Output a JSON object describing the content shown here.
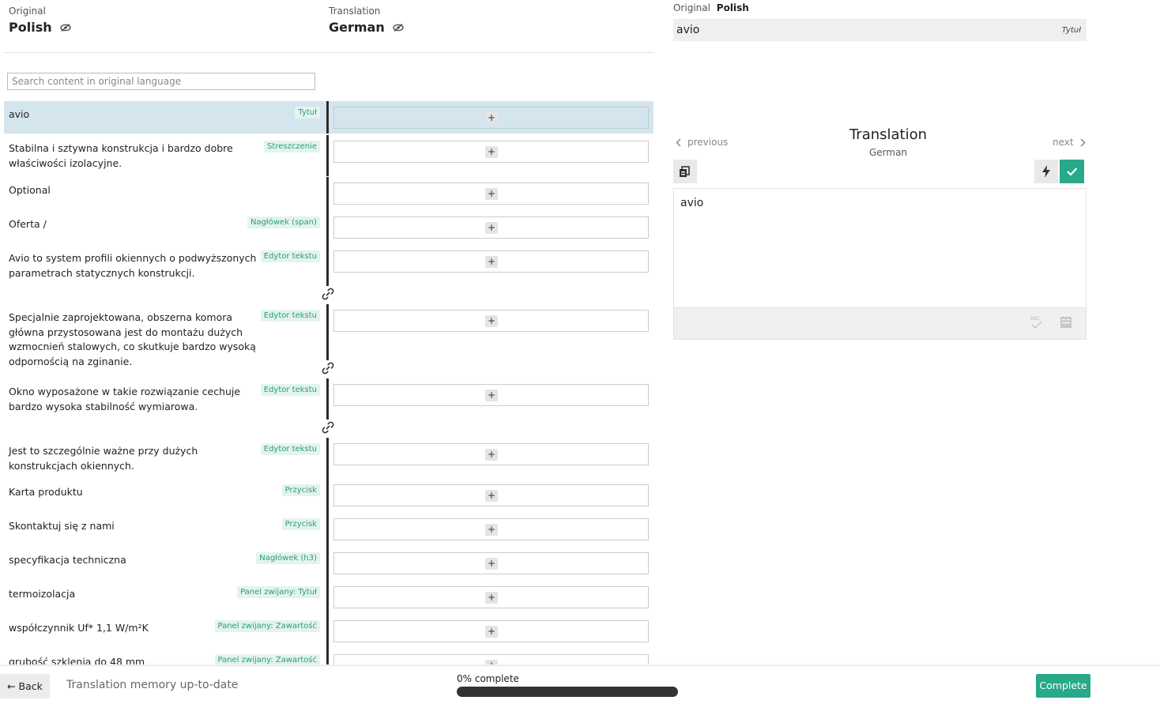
{
  "original": {
    "caption": "Original",
    "language": "Polish"
  },
  "translation": {
    "caption": "Translation",
    "language": "German"
  },
  "search": {
    "placeholder": "Search content in original language"
  },
  "segments": [
    {
      "text": "avio",
      "tag": "Tytuł"
    },
    {
      "text": "Stabilna i sztywna konstrukcja i bardzo dobre właściwości izolacyjne.",
      "tag": "Streszczenie"
    },
    {
      "text": "Optional",
      "tag": ""
    },
    {
      "text": "Oferta /",
      "tag": "Nagłówek (span)"
    },
    {
      "text": "Avio to system profili okiennych o podwyższonych parametrach statycznych konstrukcji.",
      "tag": "Edytor tekstu"
    },
    {
      "text": "Specjalnie zaprojektowana, obszerna komora główna przystosowana jest do montażu dużych wzmocnień stalowych, co skutkuje bardzo wysoką odpornością na zginanie.",
      "tag": "Edytor tekstu"
    },
    {
      "text": "Okno wyposażone w takie rozwiązanie cechuje bardzo wysoka stabilność wymiarowa.",
      "tag": "Edytor tekstu"
    },
    {
      "text": "Jest to szczególnie ważne przy dużych konstrukcjach okiennych.",
      "tag": "Edytor tekstu"
    },
    {
      "text": "Karta produktu",
      "tag": "Przycisk"
    },
    {
      "text": "Skontaktuj się z nami",
      "tag": "Przycisk"
    },
    {
      "text": "specyfikacja techniczna",
      "tag": "Nagłówek (h3)"
    },
    {
      "text": "termoizolacja",
      "tag": "Panel zwijany: Tytuł"
    },
    {
      "text": "współczynnik Uf* 1,1 W/m²K",
      "tag": "Panel zwijany: Zawartość"
    },
    {
      "text": "grubość szklenia do 48 mm",
      "tag": "Panel zwijany: Zawartość"
    }
  ],
  "add_symbol": "+",
  "panel": {
    "original_caption": "Original",
    "original_language": "Polish",
    "original_text": "avio",
    "original_tag": "Tytuł",
    "title": "Translation",
    "subtitle": "German",
    "previous": "previous",
    "next": "next",
    "value": "avio"
  },
  "footer": {
    "back": "← Back",
    "memory_status": "Translation memory up-to-date",
    "progress_label": "0% complete",
    "progress_fraction": 0,
    "complete": "Complete"
  },
  "colors": {
    "accent": "#27a98a",
    "selected_row": "#d5e5ee"
  },
  "icons": [
    "eye-slash-icon",
    "plus-icon",
    "link-icon",
    "chevron-left-icon",
    "chevron-right-icon",
    "copy-source-icon",
    "bolt-icon",
    "check-icon",
    "spellcheck-icon",
    "dictionary-icon"
  ]
}
